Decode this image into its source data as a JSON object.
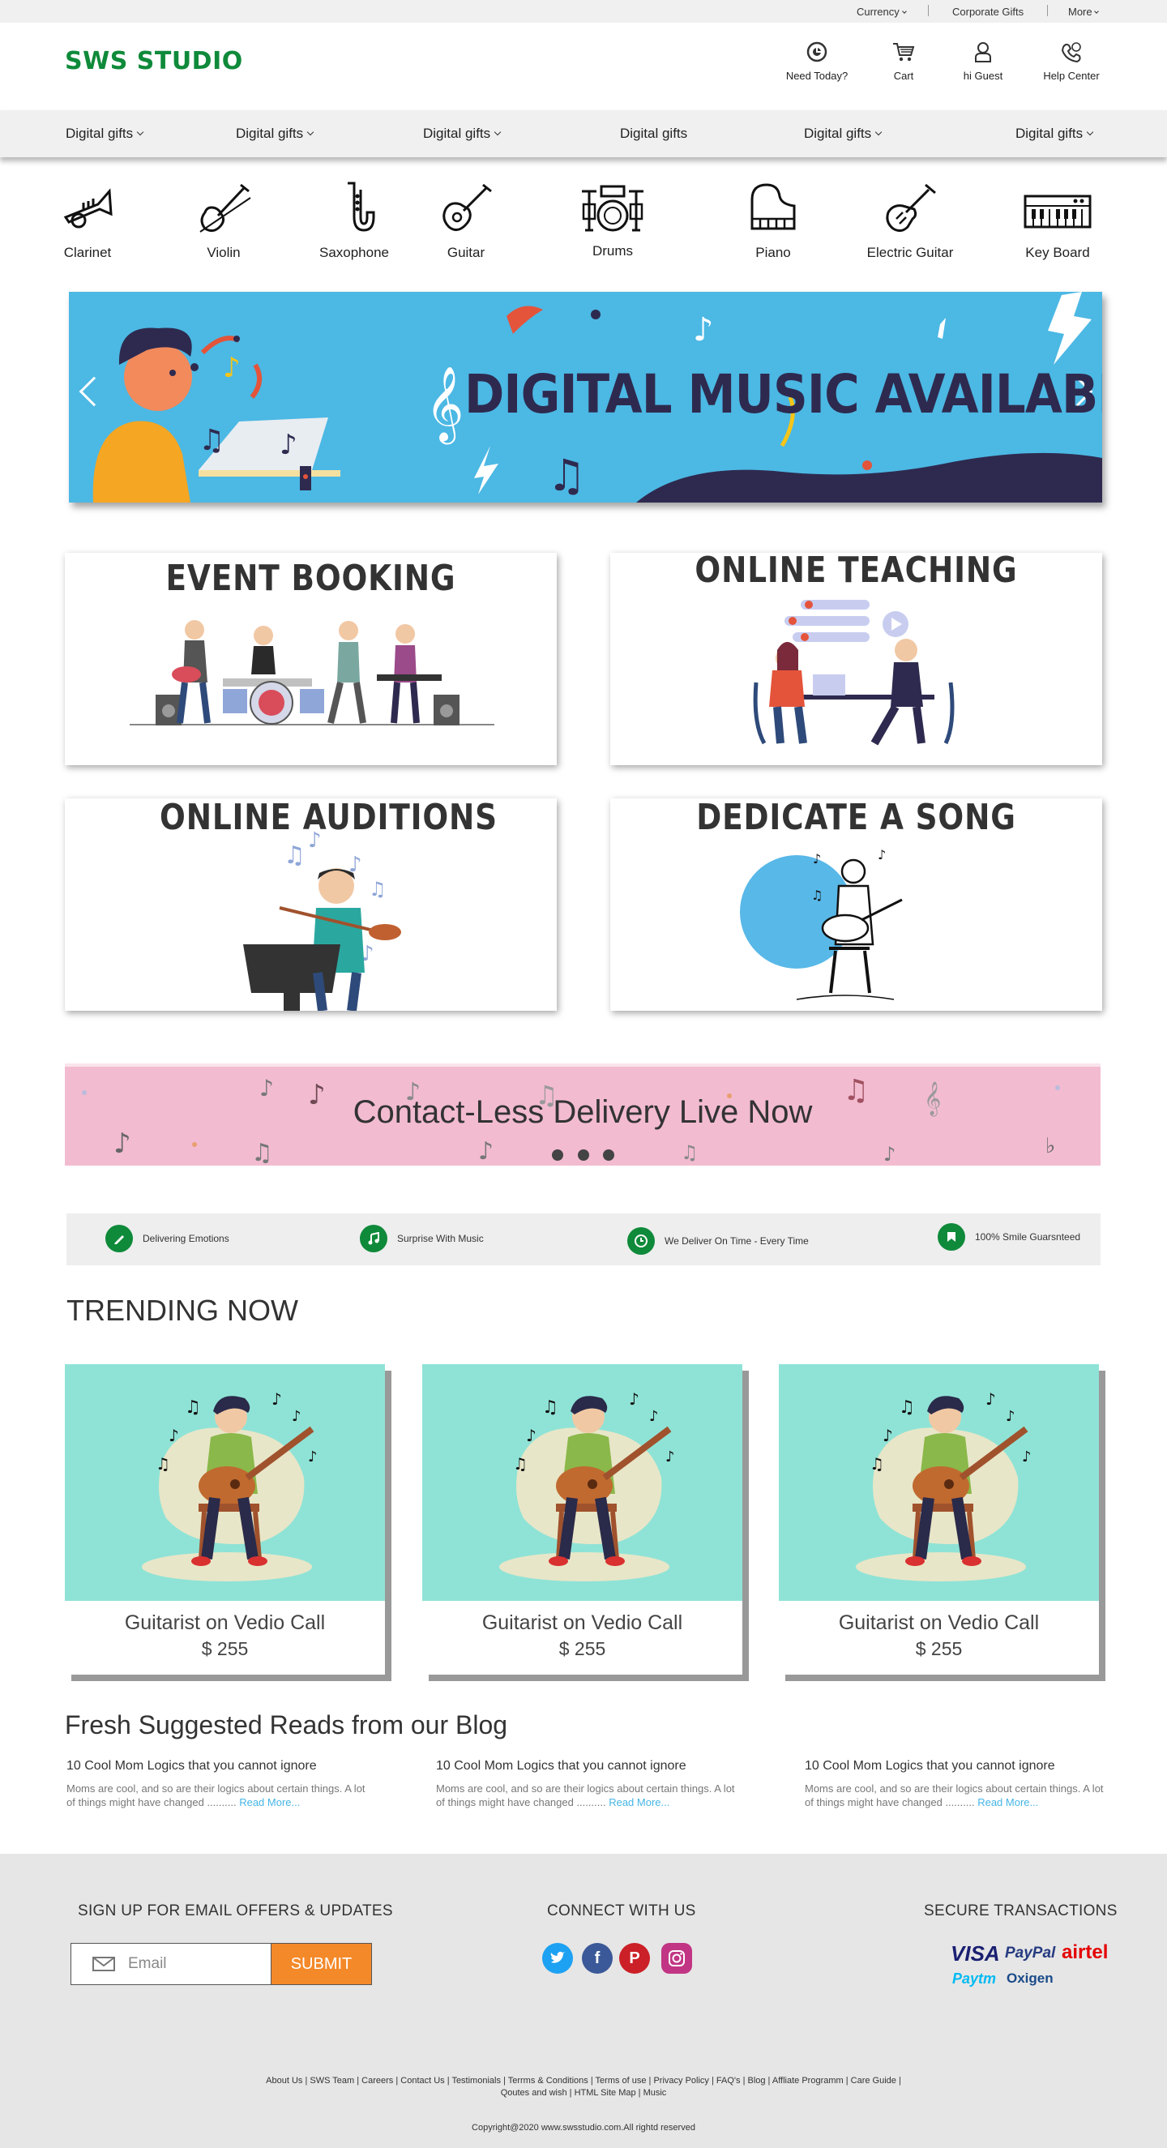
{
  "utilbar": {
    "currency": "Currency",
    "corporate": "Corporate Gifts",
    "more": "More"
  },
  "header": {
    "logo": "SWS STUDIO",
    "need_today": "Need Today?",
    "cart": "Cart",
    "guest": "hi Guest",
    "help": "Help Center"
  },
  "nav": {
    "items": [
      {
        "label": "Digital gifts"
      },
      {
        "label": "Digital gifts"
      },
      {
        "label": "Digital gifts"
      },
      {
        "label": "Digital gifts"
      },
      {
        "label": "Digital gifts"
      },
      {
        "label": "Digital gifts"
      }
    ]
  },
  "instruments": [
    {
      "label": "Clarinet",
      "icon": "trumpet-icon"
    },
    {
      "label": "Violin",
      "icon": "violin-icon"
    },
    {
      "label": "Saxophone",
      "icon": "saxophone-icon"
    },
    {
      "label": "Guitar",
      "icon": "guitar-icon"
    },
    {
      "label": "Drums",
      "icon": "drums-icon"
    },
    {
      "label": "Piano",
      "icon": "piano-icon"
    },
    {
      "label": "Electric Guitar",
      "icon": "electric-guitar-icon"
    },
    {
      "label": "Key Board",
      "icon": "keyboard-icon"
    }
  ],
  "hero": {
    "text": "DIGITAL MUSIC AVAILABLE",
    "bg_color": "#4cb8e4"
  },
  "services": [
    {
      "title": "EVENT BOOKING"
    },
    {
      "title": "ONLINE TEACHING"
    },
    {
      "title": "ONLINE AUDITIONS"
    },
    {
      "title": "DEDICATE A SONG"
    }
  ],
  "delivery": {
    "text": "Contact-Less Delivery Live Now",
    "bg_color": "#f2bbd0"
  },
  "features": [
    {
      "label": "Delivering Emotions",
      "icon": "pen-icon"
    },
    {
      "label": "Surprise With Music",
      "icon": "music-note-icon"
    },
    {
      "label": "We Deliver On Time - Every Time",
      "icon": "clock-icon"
    },
    {
      "label": "100% Smile Guarsnteed",
      "icon": "badge-icon"
    }
  ],
  "trending": {
    "title": "TRENDING NOW",
    "items": [
      {
        "name": "Guitarist on Vedio Call",
        "price": "$ 255"
      },
      {
        "name": "Guitarist on Vedio Call",
        "price": "$ 255"
      },
      {
        "name": "Guitarist on Vedio Call",
        "price": "$ 255"
      }
    ]
  },
  "blog": {
    "title": "Fresh Suggested Reads from our Blog",
    "posts": [
      {
        "title": "10 Cool Mom Logics that you cannot ignore",
        "desc": "Moms are cool, and so are their logics about certain things. A lot of things might have changed ..........",
        "read_more": "Read More..."
      },
      {
        "title": "10 Cool Mom Logics that you cannot ignore",
        "desc": "Moms are cool, and so are their logics about certain things. A lot of things might have changed ..........",
        "read_more": "Read More..."
      },
      {
        "title": "10 Cool Mom Logics that you cannot ignore",
        "desc": "Moms are cool, and so are their logics about certain things. A lot of things might have changed ..........",
        "read_more": "Read More..."
      }
    ]
  },
  "footer": {
    "signup": "SIGN UP FOR EMAIL OFFERS & UPDATES",
    "email_placeholder": "Email",
    "submit": "SUBMIT",
    "connect": "CONNECT WITH US",
    "secure": "SECURE TRANSACTIONS",
    "payments": [
      "VISA",
      "PayPal",
      "airtel",
      "Paytm",
      "Oxigen"
    ],
    "links_line1": "About Us  |  SWS Team  |  Careers  |  Contact Us  |  Testimonials  |  Terrms & Conditions  |  Terms of use  |  Privacy Policy  |  FAQ's  |  Blog  |  Affliate Programm  |  Care Guide  |",
    "links_line2": "Qoutes and wish  |  HTML Site Map  |  Music",
    "copyright": "Copyright@2020 www.swsstudio.com.All rightd reserved"
  },
  "colors": {
    "brand_green": "#0f8a3a",
    "submit_orange": "#f4892a",
    "link_blue": "#46b5e5",
    "trending_bg": "#8fe3d6"
  }
}
